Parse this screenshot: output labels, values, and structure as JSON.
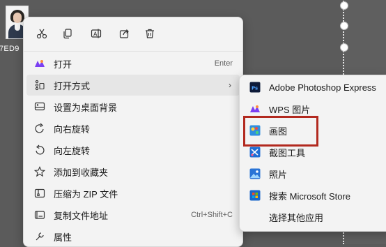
{
  "desktop": {
    "file_name": "7ED9"
  },
  "toolbar": {
    "cut": "cut-icon",
    "copy": "copy-icon",
    "rename": "rename-icon",
    "share": "share-icon",
    "delete": "delete-icon"
  },
  "menu": {
    "items": [
      {
        "label": "打开",
        "shortcut": "Enter"
      },
      {
        "label": "打开方式",
        "arrow": "›"
      },
      {
        "label": "设置为桌面背景"
      },
      {
        "label": "向右旋转"
      },
      {
        "label": "向左旋转"
      },
      {
        "label": "添加到收藏夹"
      },
      {
        "label": "压缩为 ZIP 文件"
      },
      {
        "label": "复制文件地址",
        "shortcut": "Ctrl+Shift+C"
      },
      {
        "label": "属性"
      }
    ]
  },
  "submenu": {
    "items": [
      {
        "label": "Adobe Photoshop Express"
      },
      {
        "label": "WPS 图片"
      },
      {
        "label": "画图"
      },
      {
        "label": "截图工具"
      },
      {
        "label": "照片"
      },
      {
        "label": "搜索 Microsoft Store"
      },
      {
        "label": "选择其他应用"
      }
    ]
  },
  "colors": {
    "highlight_border": "#b2291f",
    "menu_bg": "#f3f3f3",
    "hover_bg": "#e6e6e6"
  }
}
